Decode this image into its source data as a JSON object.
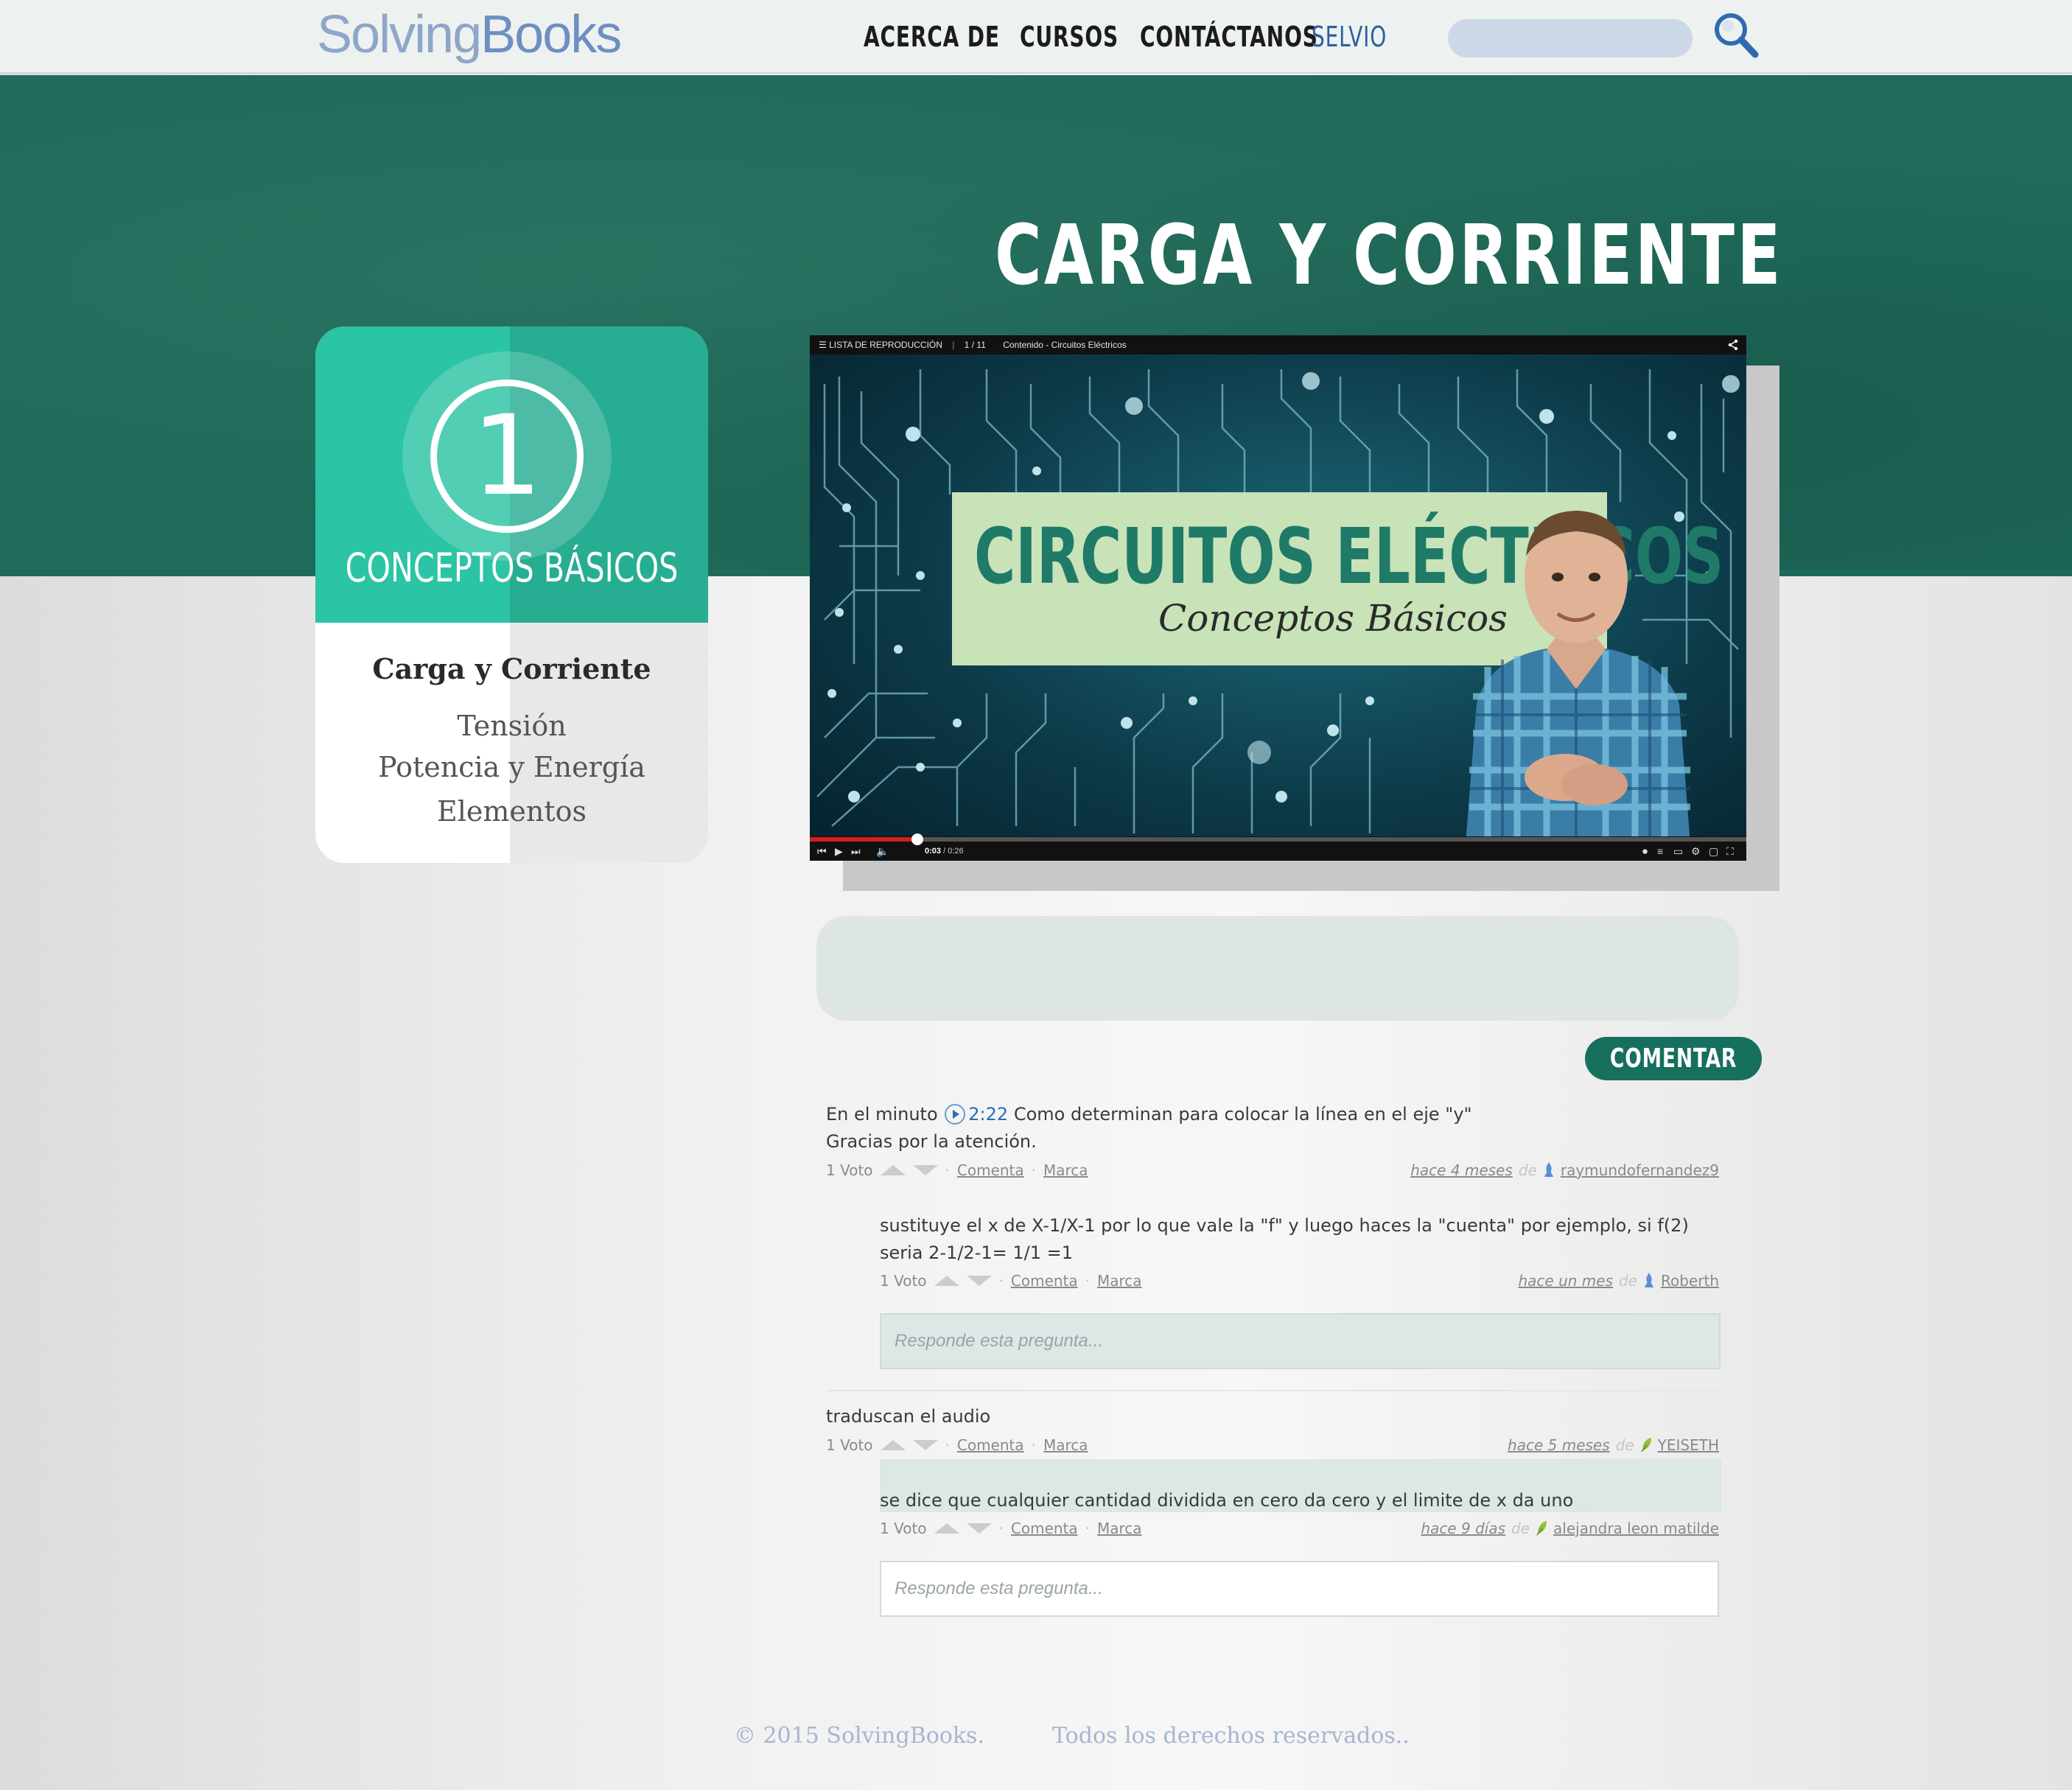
{
  "header": {
    "logo": "SolvingBooks",
    "nav": [
      "ACERCA DE",
      "CURSOS",
      "CONTÁCTANOS"
    ],
    "user": "SELVIO",
    "search": {
      "value": "",
      "placeholder": ""
    }
  },
  "hero": {
    "title": "CARGA Y CORRIENTE"
  },
  "chapter": {
    "number": "1",
    "title": "CONCEPTOS BÁSICOS",
    "lessons": [
      {
        "label": "Carga y Corriente",
        "active": true
      },
      {
        "label": "Tensión",
        "active": false
      },
      {
        "label": "Potencia y Energía",
        "active": false
      },
      {
        "label": "Elementos",
        "active": false
      }
    ]
  },
  "video": {
    "playlist_label": "LISTA DE REPRODUCCIÓN",
    "playlist_position": "1 / 11",
    "video_title": "Contenido - Circuitos Eléctricos",
    "plate_title": "CIRCUITOS ELÉCTRICOS",
    "plate_subtitle": "Conceptos Básicos",
    "time_current": "0:03",
    "time_total": "0:26",
    "progress_fraction": 0.115
  },
  "comment_form": {
    "value": "",
    "button_label": "COMENTAR"
  },
  "thread": [
    {
      "prefix": "En el minuto",
      "timestamp": "2:22",
      "text": "Como determinan para colocar la línea en el eje \"y\"",
      "text2": "Gracias por la atención.",
      "votes": "1 Voto",
      "comment_label": "Comenta",
      "flag_label": "Marca",
      "ago": "hace 4 meses",
      "de": "de",
      "user": "raymundofernandez9",
      "answers": [
        {
          "text": "sustituye el x de X-1/X-1 por lo que vale la \"f\" y luego haces la \"cuenta\" por ejemplo, si f(2) seria 2-1/2-1= 1/1 =1",
          "votes": "1 Voto",
          "comment_label": "Comenta",
          "flag_label": "Marca",
          "ago": "hace un mes",
          "de": "de",
          "user": "Roberth"
        }
      ],
      "reply_placeholder": "Responde esta pregunta..."
    },
    {
      "text": "traduscan el audio",
      "votes": "1 Voto",
      "comment_label": "Comenta",
      "flag_label": "Marca",
      "ago": "hace 5 meses",
      "de": "de",
      "user": "YEISETH",
      "answers": [
        {
          "text": "se dice que cualquier cantidad dividida en cero da cero y el limite de x da uno",
          "votes": "1 Voto",
          "comment_label": "Comenta",
          "flag_label": "Marca",
          "ago": "hace 9 días",
          "de": "de",
          "user": "alejandra leon matilde"
        }
      ],
      "reply_placeholder": "Responde esta pregunta..."
    }
  ],
  "footer": {
    "copyright": "© 2015 SolvingBooks.",
    "rights": "Todos los derechos reservados.."
  },
  "colors": {
    "brand_green": "#1f6a5a",
    "chapter_teal": "#2bc4a4",
    "button_green": "#17705e",
    "link_blue": "#2d6bb3",
    "logo_blue": "#8ea6c8"
  }
}
